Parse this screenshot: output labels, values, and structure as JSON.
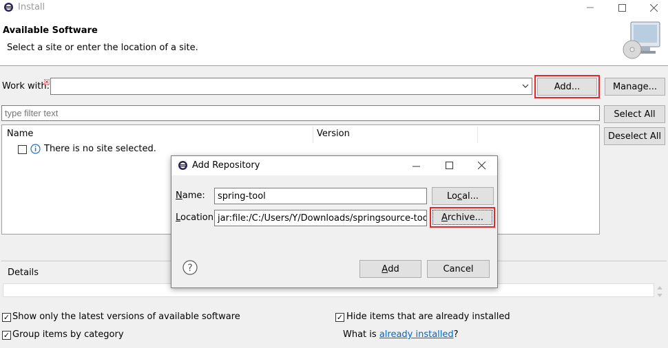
{
  "window": {
    "title": "Install"
  },
  "header": {
    "title": "Available Software",
    "subtitle": "Select a site or enter the location of a site."
  },
  "work_with": {
    "label": "Work with:",
    "value": "",
    "add_button": "Add...",
    "manage_button": "Manage..."
  },
  "filter": {
    "placeholder": "type filter text"
  },
  "side_buttons": {
    "select_all": "Select All",
    "deselect_all": "Deselect All"
  },
  "table": {
    "columns": [
      "Name",
      "Version"
    ],
    "rows": [
      {
        "name": "There is no site selected."
      }
    ]
  },
  "details": {
    "label": "Details"
  },
  "options": {
    "show_latest": "Show only the latest versions of available software",
    "group_by_category": "Group items by category",
    "hide_installed": "Hide items that are already installed",
    "what_is": "What is ",
    "already_installed": "already installed",
    "question_mark": "?"
  },
  "dialog": {
    "title": "Add Repository",
    "name_label": "Name:",
    "name_value": "spring-tool",
    "location_label": "Location:",
    "location_value": "jar:file:/C:/Users/Y/Downloads/springsource-tool-su",
    "local_button": "Local...",
    "archive_button": "Archive...",
    "add_button": "Add",
    "cancel_button": "Cancel",
    "help_glyph": "?"
  },
  "colors": {
    "highlight": "#e8262a",
    "link": "#0066cc"
  }
}
